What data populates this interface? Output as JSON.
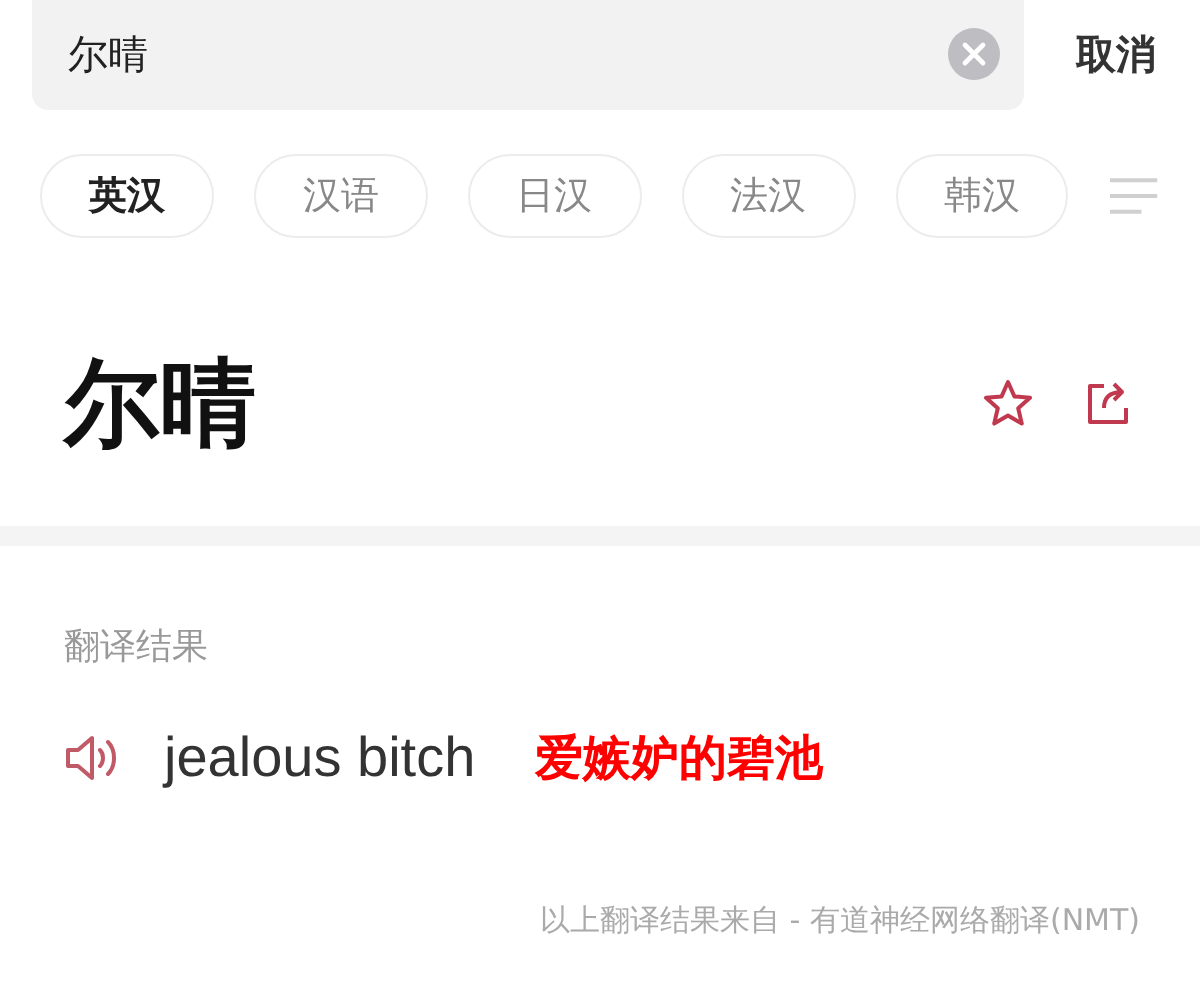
{
  "search": {
    "value": "尔晴",
    "cancel": "取消"
  },
  "tabs": [
    {
      "label": "英汉",
      "selected": true
    },
    {
      "label": "汉语",
      "selected": false
    },
    {
      "label": "日汉",
      "selected": false
    },
    {
      "label": "法汉",
      "selected": false
    },
    {
      "label": "韩汉",
      "selected": false
    }
  ],
  "headword": "尔晴",
  "result": {
    "heading": "翻译结果",
    "translation": "jealous bitch",
    "note": "爱嫉妒的碧池"
  },
  "footer": "以上翻译结果来自 - 有道神经网络翻译(NMT)"
}
